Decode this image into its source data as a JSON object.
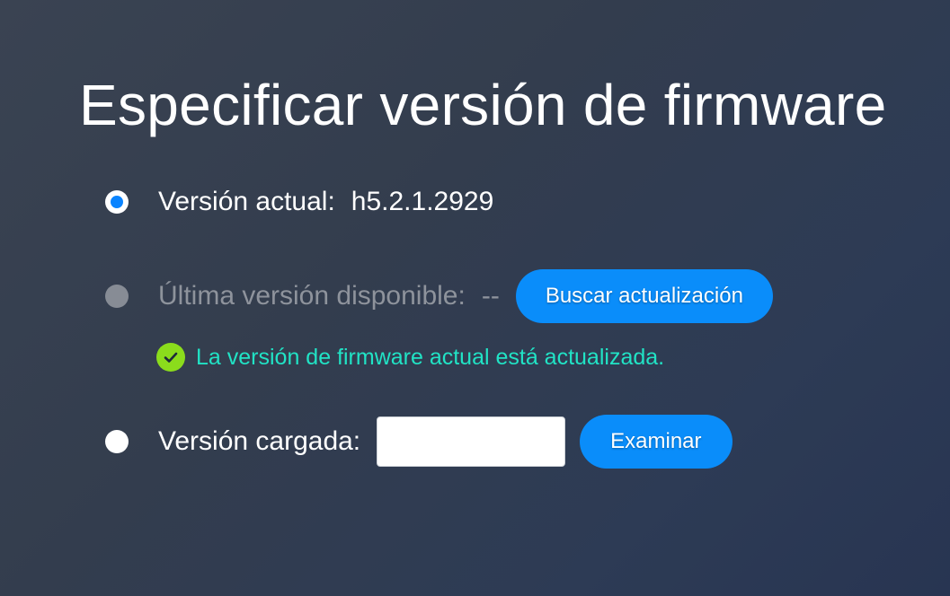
{
  "page": {
    "title": "Especificar versión de firmware"
  },
  "current": {
    "label": "Versión actual:",
    "value": "h5.2.1.2929",
    "selected": true
  },
  "latest": {
    "label": "Última versión disponible:",
    "value": "--",
    "button_label": "Buscar actualización",
    "enabled": false
  },
  "status": {
    "icon": "check-circle-icon",
    "text": "La versión de firmware actual está actualizada.",
    "color": "#21e3c5",
    "icon_color": "#8bdc1c"
  },
  "uploaded": {
    "label": "Versión cargada:",
    "input_value": "",
    "button_label": "Examinar",
    "selected": false
  },
  "colors": {
    "accent": "#0a8dfa",
    "radio_selected": "#0a84ff",
    "disabled_text": "#8e939c"
  }
}
